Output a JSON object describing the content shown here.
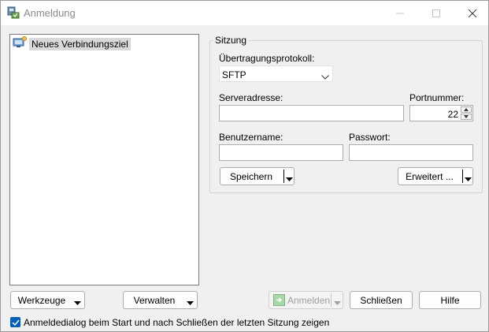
{
  "window": {
    "title": "Anmeldung"
  },
  "tree": {
    "items": [
      {
        "label": "Neues Verbindungsziel"
      }
    ]
  },
  "session": {
    "group_label": "Sitzung",
    "protocol_label": "Übertragungsprotokoll:",
    "protocol_value": "SFTP",
    "host_label": "Serveradresse:",
    "host_value": "",
    "port_label": "Portnummer:",
    "port_value": "22",
    "user_label": "Benutzername:",
    "user_value": "",
    "password_label": "Passwort:",
    "password_value": "",
    "save_button": "Speichern",
    "advanced_button": "Erweitert ..."
  },
  "footer": {
    "tools_button": "Werkzeuge",
    "manage_button": "Verwalten",
    "login_button": "Anmelden",
    "close_button": "Schließen",
    "help_button": "Hilfe",
    "show_on_start_label": "Anmeldedialog beim Start und nach Schließen der letzten Sitzung zeigen",
    "show_on_start_checked": true
  },
  "colors": {
    "accent": "#005fb8",
    "selection": "#d9d9d9"
  }
}
